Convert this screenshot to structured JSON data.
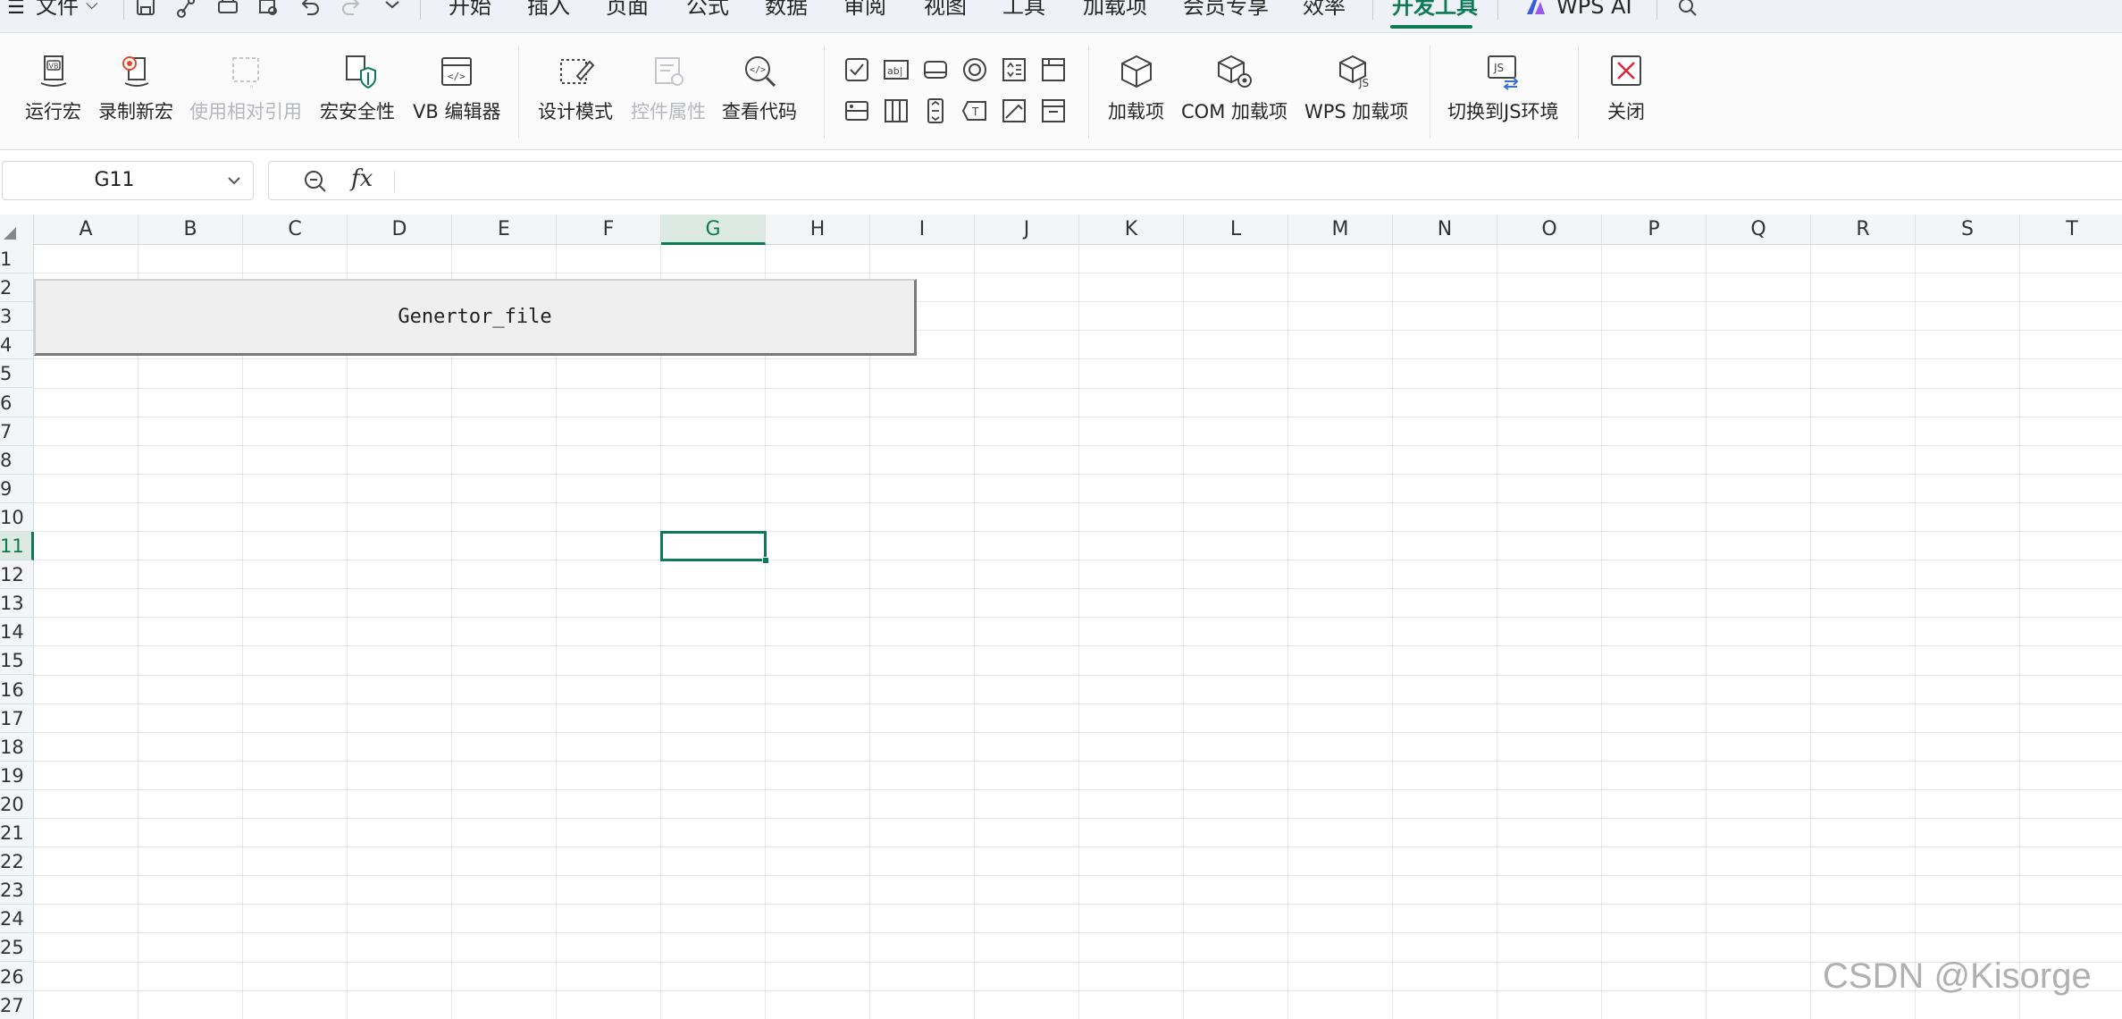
{
  "menubar": {
    "file_label": "文件",
    "tabs": [
      {
        "label": "开始"
      },
      {
        "label": "插入"
      },
      {
        "label": "页面"
      },
      {
        "label": "公式"
      },
      {
        "label": "数据"
      },
      {
        "label": "审阅"
      },
      {
        "label": "视图"
      },
      {
        "label": "工具"
      },
      {
        "label": "加载项"
      },
      {
        "label": "会员专享"
      },
      {
        "label": "效率"
      },
      {
        "label": "开发工具",
        "active": true
      },
      {
        "label": "WPS AI"
      }
    ],
    "accent_color": "#0e7a54"
  },
  "ribbon": {
    "buttons": [
      {
        "label": "运行宏",
        "icon": "vb-run-macro-icon",
        "enabled": true
      },
      {
        "label": "录制新宏",
        "icon": "record-macro-icon",
        "enabled": true
      },
      {
        "label": "使用相对引用",
        "icon": "relative-reference-icon",
        "enabled": false
      },
      {
        "label": "宏安全性",
        "icon": "macro-security-icon",
        "enabled": true
      },
      {
        "label": "VB 编辑器",
        "icon": "vb-editor-icon",
        "enabled": true
      },
      {
        "label": "设计模式",
        "icon": "design-mode-icon",
        "enabled": true
      },
      {
        "label": "控件属性",
        "icon": "control-properties-icon",
        "enabled": false
      },
      {
        "label": "查看代码",
        "icon": "view-code-icon",
        "enabled": true
      },
      {
        "label": "加载项",
        "icon": "addin-cube-icon",
        "enabled": true
      },
      {
        "label": "COM 加载项",
        "icon": "com-addin-icon",
        "enabled": true
      },
      {
        "label": "WPS 加载项",
        "icon": "wps-addin-icon",
        "enabled": true
      },
      {
        "label": "切换到JS环境",
        "icon": "switch-js-icon",
        "enabled": true
      },
      {
        "label": "关闭",
        "icon": "close-icon",
        "enabled": true
      }
    ],
    "controls": [
      "checkbox-control-icon",
      "label-control-icon",
      "button-control-icon",
      "radio-control-icon",
      "spinner-control-icon",
      "groupbox-control-icon",
      "combobox-control-icon",
      "listbox-control-icon",
      "scrollbar-control-icon",
      "textbox-control-icon",
      "image-control-icon",
      "frame-control-icon"
    ]
  },
  "formula_bar": {
    "name_box": "G11",
    "fx_label": "fx",
    "formula": ""
  },
  "sheet": {
    "columns": [
      "A",
      "B",
      "C",
      "D",
      "E",
      "F",
      "G",
      "H",
      "I",
      "J",
      "K",
      "L",
      "M",
      "N",
      "O",
      "P",
      "Q",
      "R",
      "S",
      "T"
    ],
    "rows": [
      "1",
      "2",
      "3",
      "4",
      "5",
      "6",
      "7",
      "8",
      "9",
      "10",
      "11",
      "12",
      "13",
      "14",
      "15",
      "16",
      "17",
      "18",
      "19",
      "20",
      "21",
      "22",
      "23",
      "24",
      "25",
      "26",
      "27"
    ],
    "selected_cell": "G11",
    "form_button_label": "Genertor_file"
  },
  "watermark": "CSDN @Kisorge"
}
